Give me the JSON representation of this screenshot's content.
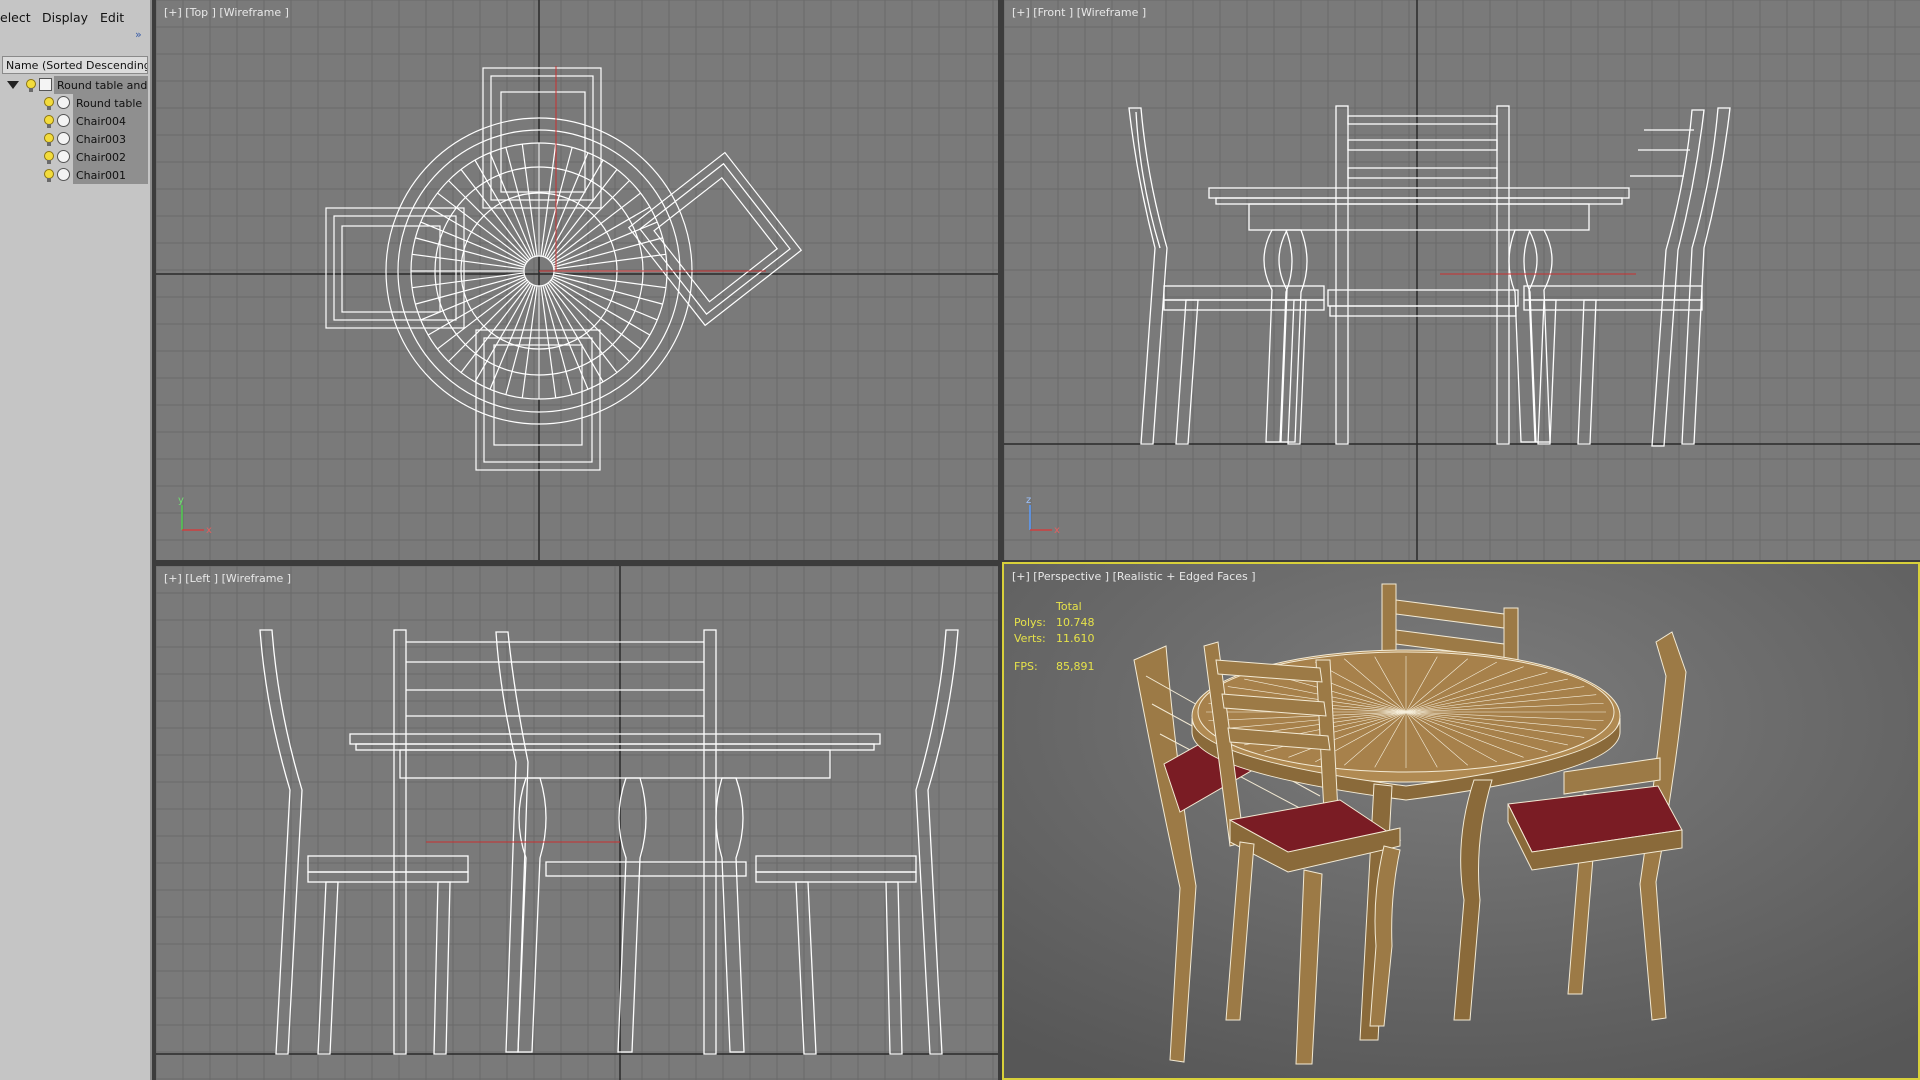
{
  "menu": {
    "select": "elect",
    "display": "Display",
    "edit": "Edit",
    "expand": "»"
  },
  "explorer": {
    "column_header": "Name (Sorted Descending)",
    "items": [
      {
        "label": "Round table and ch"
      },
      {
        "label": "Round table"
      },
      {
        "label": "Chair004"
      },
      {
        "label": "Chair003"
      },
      {
        "label": "Chair002"
      },
      {
        "label": "Chair001"
      }
    ]
  },
  "viewports": {
    "top": {
      "label": "[+] [Top ] [Wireframe ]"
    },
    "front": {
      "label": "[+] [Front ] [Wireframe ]"
    },
    "left": {
      "label": "[+] [Left ] [Wireframe ]"
    },
    "perspective": {
      "label": "[+] [Perspective ] [Realistic + Edged Faces ]"
    }
  },
  "stats": {
    "total_label": "Total",
    "polys_label": "Polys:",
    "polys_value": "10.748",
    "verts_label": "Verts:",
    "verts_value": "11.610",
    "fps_label": "FPS:",
    "fps_value": "85,891"
  },
  "axes": {
    "x": "x",
    "y": "y",
    "z": "z"
  },
  "colors": {
    "viewport_bg": "#7a7a7a",
    "grid": "#6a6a6a",
    "wireframe": "#ffffff",
    "active_border": "#d8d03a",
    "wood": "#9c7a46",
    "seat": "#7a1c24",
    "stats_text": "#e6e24a"
  }
}
